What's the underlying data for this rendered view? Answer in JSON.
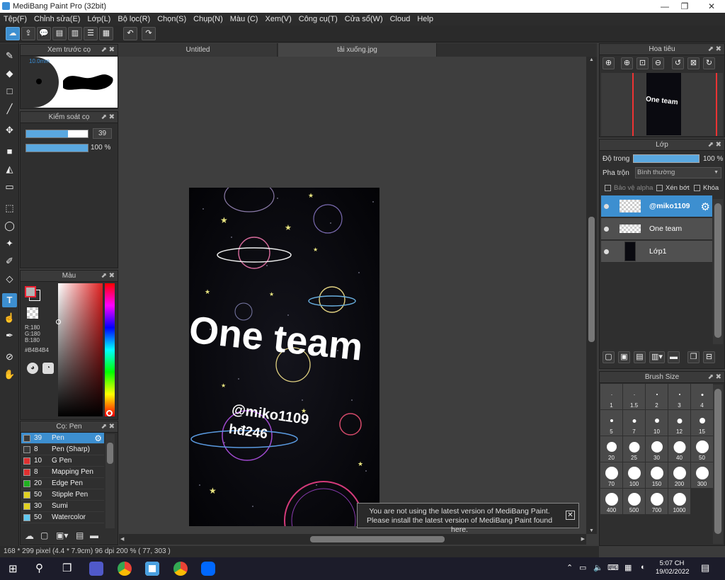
{
  "window": {
    "title": "MediBang Paint Pro (32bit)"
  },
  "menu": [
    "Tệp(F)",
    "Chỉnh sửa(E)",
    "Lớp(L)",
    "Bộ lọc(R)",
    "Chọn(S)",
    "Chụp(N)",
    "Màu (C)",
    "Xem(V)",
    "Công cụ(T)",
    "Cửa sổ(W)",
    "Cloud",
    "Help"
  ],
  "tabs": [
    "Untitled",
    "tải xuống.jpg"
  ],
  "panels": {
    "brush_preview": "Xem trước cọ",
    "brush_control": "Kiểm soát cọ",
    "color": "Màu",
    "brush_list": "Cọ: Pen",
    "navigator": "Hoa tiêu",
    "layers": "Lớp",
    "brush_size": "Brush Size"
  },
  "brush_control": {
    "size": "39",
    "opacity": "100 %",
    "size_fraction": 0.68,
    "opacity_fraction": 1.0
  },
  "brush_preview": {
    "size_label": "10.0mm"
  },
  "color": {
    "r": "R:180",
    "g": "G:180",
    "b": "B:180",
    "hex": "#B4B4B4",
    "fg": "#b4b4b4"
  },
  "brushes": [
    {
      "size": "39",
      "name": "Pen",
      "color": "#3a3a3a"
    },
    {
      "size": "8",
      "name": "Pen (Sharp)",
      "color": "#3a3a3a"
    },
    {
      "size": "10",
      "name": "G Pen",
      "color": "#e03030"
    },
    {
      "size": "8",
      "name": "Mapping Pen",
      "color": "#e03030"
    },
    {
      "size": "20",
      "name": "Edge Pen",
      "color": "#20b020"
    },
    {
      "size": "50",
      "name": "Stipple Pen",
      "color": "#e0d020"
    },
    {
      "size": "30",
      "name": "Sumi",
      "color": "#e0d020"
    },
    {
      "size": "50",
      "name": "Watercolor",
      "color": "#60c8f0"
    }
  ],
  "layers_panel": {
    "opacity_label": "Độ trong",
    "opacity_value": "100 %",
    "blend_label": "Pha trộn",
    "blend_value": "Bình thường",
    "protect_alpha": "Bảo vệ alpha",
    "clipping": "Xén bớt",
    "lock": "Khóa"
  },
  "layers": [
    {
      "name": "@miko1109"
    },
    {
      "name": "One team"
    },
    {
      "name": "Lớp1"
    }
  ],
  "brush_sizes": [
    "1",
    "1.5",
    "2",
    "3",
    "4",
    "5",
    "7",
    "10",
    "12",
    "15",
    "20",
    "25",
    "30",
    "40",
    "50",
    "70",
    "100",
    "150",
    "200",
    "300",
    "400",
    "500",
    "700",
    "1000"
  ],
  "artwork": {
    "line1": "One team",
    "line2": "@miko1109",
    "line3": "hđ246"
  },
  "notice": {
    "line1": "You are not using the latest version of MediBang Paint.",
    "line2": "Please install the latest version of MediBang Paint found here."
  },
  "status": "168 * 299 pixel   (4.4 * 7.9cm)   96 dpi   200 %   ( 77, 303 )",
  "clock": {
    "time": "5:07 CH",
    "date": "19/02/2022"
  }
}
